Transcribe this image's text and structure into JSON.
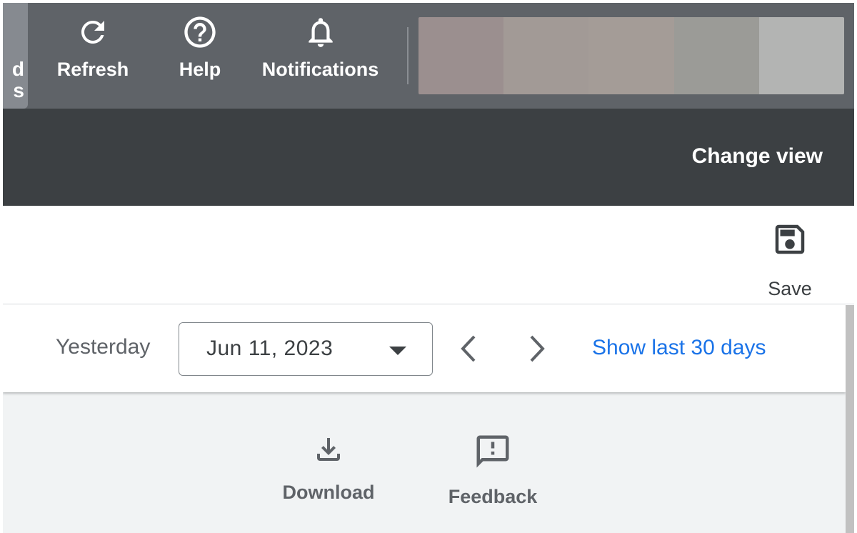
{
  "toolbar": {
    "partial_tab_label": "d\ns",
    "refresh": {
      "label": "Refresh",
      "icon": "refresh-icon"
    },
    "help": {
      "label": "Help",
      "icon": "help-icon"
    },
    "notifications": {
      "label": "Notifications",
      "icon": "bell-icon"
    },
    "avatar_colors": [
      "#9b8f8f",
      "#a29a96",
      "#a49c97",
      "#9b9b97",
      "#b3b4b3"
    ]
  },
  "header": {
    "change_view_label": "Change view"
  },
  "actions": {
    "save_label": "Save",
    "save_icon": "save-icon"
  },
  "date_range": {
    "label": "Yesterday",
    "selected_date": "Jun 11, 2023",
    "show_last_label": "Show last 30 days"
  },
  "footer_actions": {
    "download_label": "Download",
    "download_icon": "download-icon",
    "feedback_label": "Feedback",
    "feedback_icon": "feedback-icon"
  },
  "colors": {
    "toolbar_bg": "#5f6368",
    "header_bg": "#3c4043",
    "link_blue": "#1a73e8",
    "footer_bg": "#f1f3f4"
  }
}
